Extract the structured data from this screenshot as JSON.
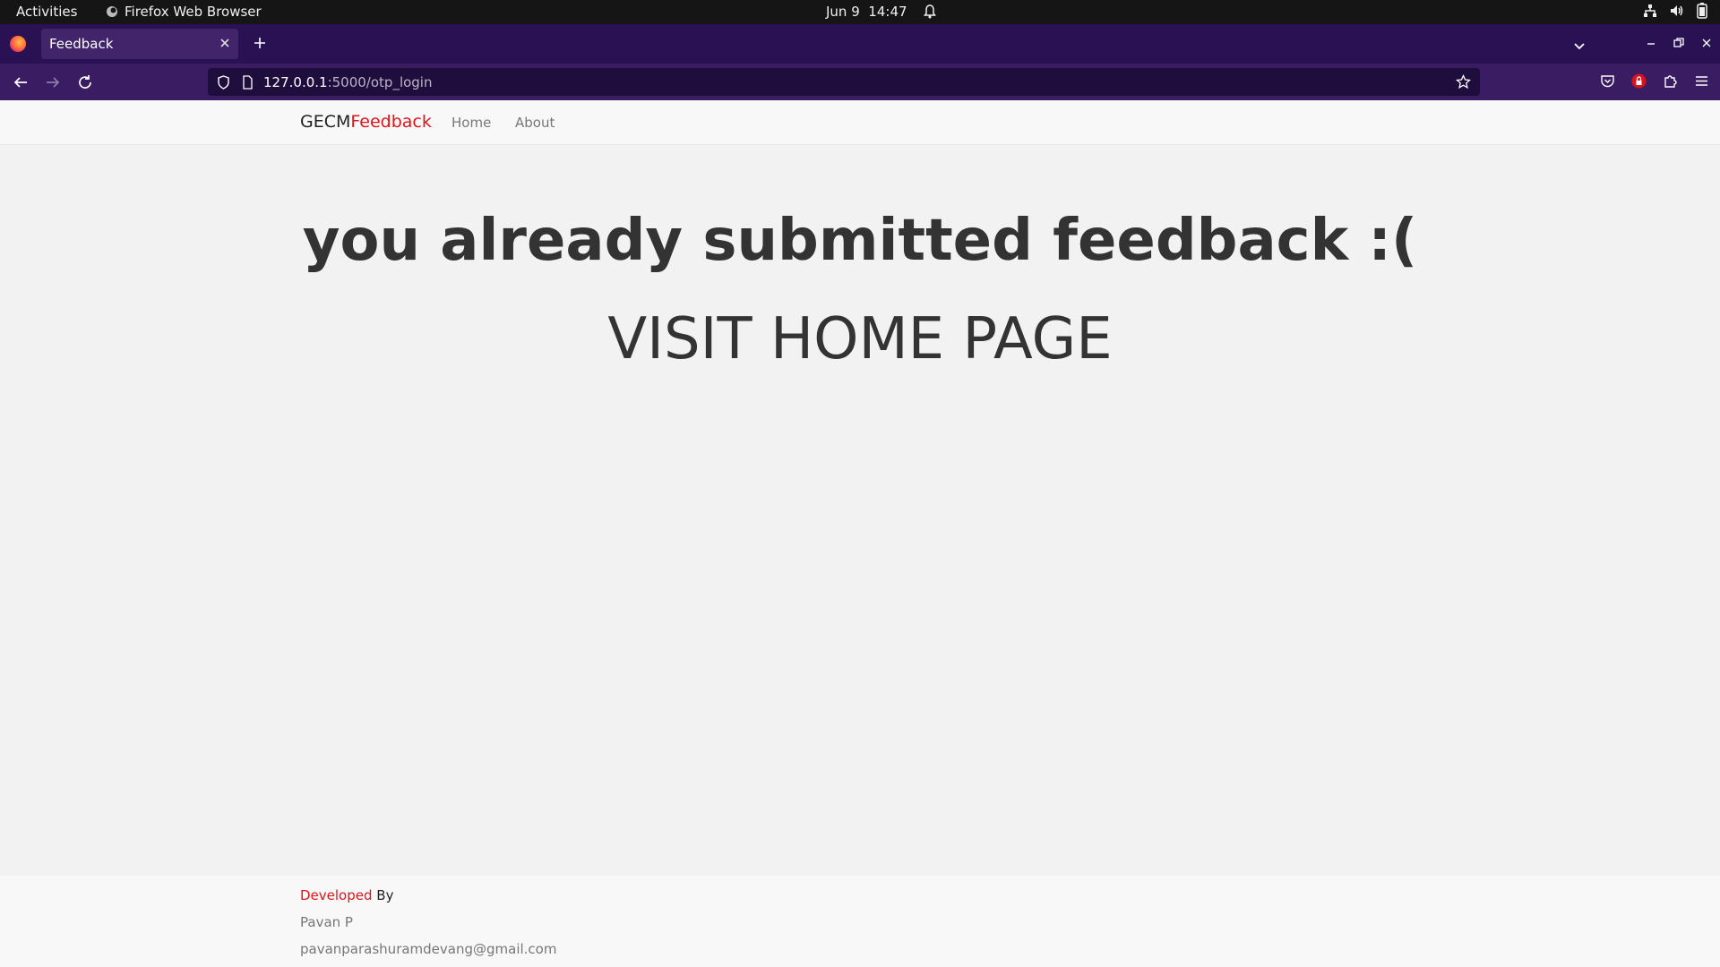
{
  "system_bar": {
    "activities": "Activities",
    "app_name": "Firefox Web Browser",
    "date": "Jun 9",
    "time": "14:47"
  },
  "browser": {
    "tab_title": "Feedback",
    "url_host": "127.0.0.1",
    "url_rest": ":5000/otp_login",
    "colors": {
      "tab_strip": "#2a1154",
      "toolbar": "#3a1c63",
      "urlbar": "#1f0e3d"
    }
  },
  "site": {
    "brand_part1": "GECM",
    "brand_part2": "Feedback",
    "nav": {
      "home": "Home",
      "about": "About"
    },
    "message": "you already submitted feedback :(",
    "home_link": "VISIT HOME PAGE",
    "footer": {
      "developed": "Developed",
      "by": " By",
      "name": "Pavan P",
      "email": "pavanparashuramdevang@gmail.com"
    },
    "colors": {
      "accent": "#e0141b",
      "text": "#333333",
      "muted": "#777777"
    }
  }
}
